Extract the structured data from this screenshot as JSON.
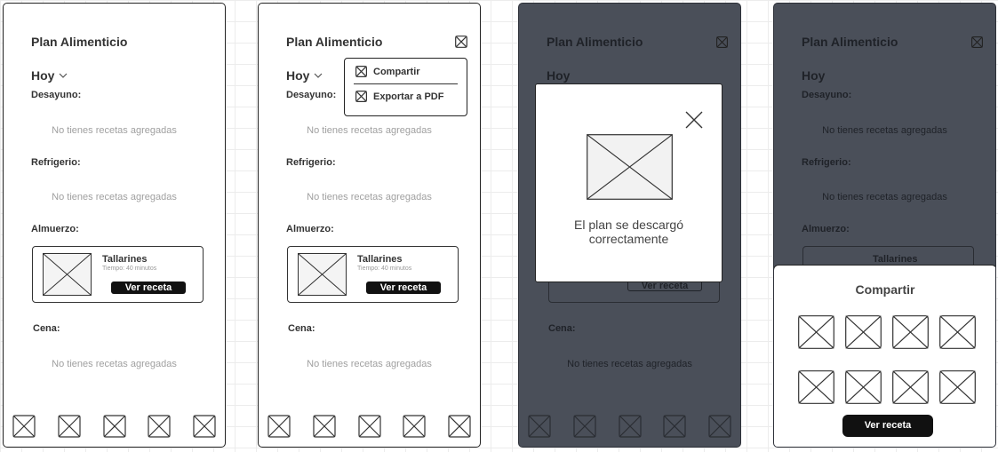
{
  "screens": [
    {
      "title": "Plan Alimenticio",
      "today": "Hoy",
      "breakfast": "Desayuno:",
      "snack": "Refrigerio:",
      "lunch": "Almuerzo:",
      "dinner": "Cena:",
      "empty": "No tienes recetas agregadas",
      "recipe_name": "Tallarines",
      "recipe_time": "Tiempo: 40 minutos",
      "recipe_button": "Ver receta"
    },
    {
      "title": "Plan Alimenticio",
      "today": "Hoy",
      "breakfast": "Desayuno:",
      "snack": "Refrigerio:",
      "lunch": "Almuerzo:",
      "dinner": "Cena:",
      "empty": "No tienes recetas agregadas",
      "recipe_name": "Tallarines",
      "recipe_time": "Tiempo: 40 minutos",
      "recipe_button": "Ver receta",
      "menu": [
        "Compartir",
        "Exportar a PDF"
      ]
    },
    {
      "title": "Plan Alimenticio",
      "today": "Hoy",
      "dinner": "Cena:",
      "empty": "No tienes recetas agregadas",
      "recipe_button": "Ver receta",
      "modal_line1": "El plan se descargó",
      "modal_line2": "correctamente"
    },
    {
      "title": "Plan Alimenticio",
      "today": "Hoy",
      "breakfast": "Desayuno:",
      "snack": "Refrigerio:",
      "lunch": "Almuerzo:",
      "empty": "No tienes recetas agregadas",
      "recipe_name": "Tallarines",
      "share_title": "Compartir",
      "share_button": "Ver receta"
    }
  ],
  "icons": {
    "placeholder": "image-placeholder-icon",
    "close": "close-icon",
    "chevron": "chevron-down-icon"
  },
  "colors": {
    "overlay": "#4a4f59",
    "button": "#111111",
    "muted_text": "#a0a0a0"
  }
}
